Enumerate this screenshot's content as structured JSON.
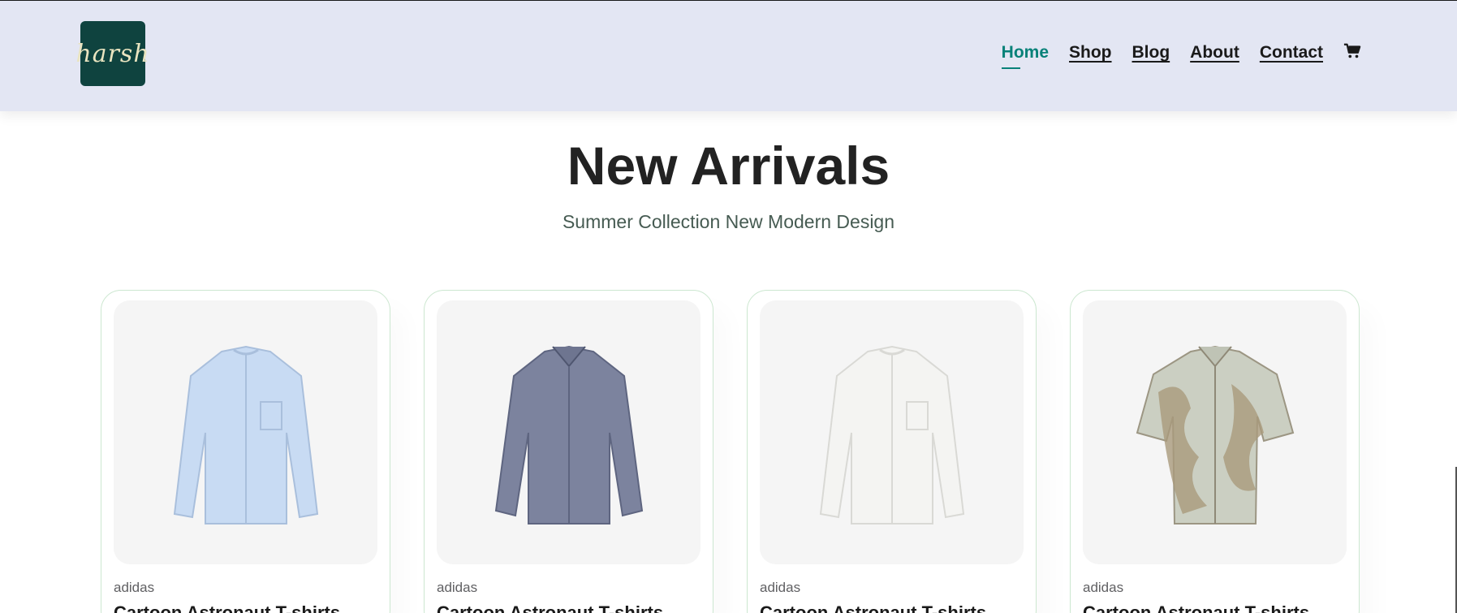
{
  "header": {
    "logo_text": "harsh",
    "nav": [
      {
        "label": "Home",
        "active": true
      },
      {
        "label": "Shop",
        "active": false
      },
      {
        "label": "Blog",
        "active": false
      },
      {
        "label": "About",
        "active": false
      },
      {
        "label": "Contact",
        "active": false
      }
    ],
    "cart_icon": "cart-icon"
  },
  "section": {
    "title": "New Arrivals",
    "subtitle": "Summer Collection New Modern Design"
  },
  "products": [
    {
      "brand": "adidas",
      "name": "Cartoon Astronaut T-shirts",
      "image": "light-blue-band-collar-shirt",
      "color": "#c8dbf3"
    },
    {
      "brand": "adidas",
      "name": "Cartoon Astronaut T-shirts",
      "image": "navy-linen-shirt",
      "color": "#7c839e"
    },
    {
      "brand": "adidas",
      "name": "Cartoon Astronaut T-shirts",
      "image": "white-band-collar-shirt",
      "color": "#f4f4f2"
    },
    {
      "brand": "adidas",
      "name": "Cartoon Astronaut T-shirts",
      "image": "printed-short-sleeve-shirt",
      "color": "#cbcfc2"
    }
  ],
  "colors": {
    "header_bg": "#e3e6f3",
    "accent": "#088178",
    "logo_bg": "#0f433f"
  }
}
